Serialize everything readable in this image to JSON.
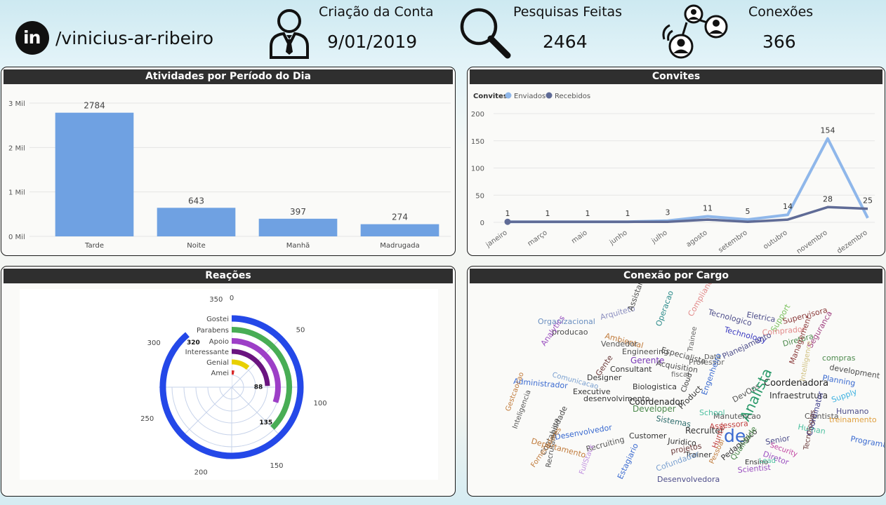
{
  "header": {
    "profile": {
      "icon": "linkedin-icon",
      "handle": "/vinicius-ar-ribeiro"
    },
    "kpis": [
      {
        "label": "Criação da Conta",
        "value": "9/01/2019",
        "icon": "person-tie-icon"
      },
      {
        "label": "Pesquisas Feitas",
        "value": "2464",
        "icon": "magnifier-icon"
      },
      {
        "label": "Conexões",
        "value": "366",
        "icon": "network-people-icon"
      }
    ]
  },
  "panels": {
    "atividades": {
      "title": "Atividades por Período do Dia"
    },
    "convites": {
      "title": "Convites"
    },
    "reacoes": {
      "title": "Reações"
    },
    "conexao": {
      "title": "Conexão por Cargo"
    }
  },
  "colors": {
    "accent_bar": "#6fa1e2",
    "enviados": "#8fb7ea",
    "recebidos": "#5f6b96",
    "reaction_ring": "#2448e8"
  },
  "chart_data": [
    {
      "type": "bar",
      "title": "Atividades por Período do Dia",
      "categories": [
        "Tarde",
        "Noite",
        "Manhã",
        "Madrugada"
      ],
      "values": [
        2784,
        643,
        397,
        274
      ],
      "data_labels": [
        "2784",
        "643",
        "397",
        "274"
      ],
      "y_ticks": [
        "0 Mil",
        "1 Mil",
        "2 Mil",
        "3 Mil"
      ],
      "ylim": [
        0,
        3000
      ],
      "grid": true
    },
    {
      "type": "line",
      "title": "Convites",
      "legend_title": "Convites",
      "categories": [
        "janeiro",
        "março",
        "maio",
        "junho",
        "julho",
        "agosto",
        "setembro",
        "outubro",
        "novembro",
        "dezembro"
      ],
      "series": [
        {
          "name": "Enviados",
          "values": [
            1,
            1,
            1,
            1,
            3,
            11,
            5,
            14,
            154,
            8
          ],
          "color": "#8fb7ea"
        },
        {
          "name": "Recebidos",
          "values": [
            1,
            null,
            null,
            null,
            1,
            5,
            1,
            5,
            28,
            25
          ],
          "color": "#5f6b96"
        }
      ],
      "data_labels": [
        "1",
        "1",
        "1",
        "1",
        "3",
        "11",
        "5",
        "14",
        "154",
        "28",
        "25"
      ],
      "y_ticks": [
        "0",
        "50",
        "100",
        "150",
        "200"
      ],
      "ylim": [
        0,
        200
      ],
      "legend_position": "top-left"
    },
    {
      "type": "radial-bar",
      "title": "Reações",
      "categories": [
        "Gostei",
        "Parabens",
        "Apoio",
        "Interessante",
        "Genial",
        "Amei"
      ],
      "values": [
        320,
        135,
        109,
        88,
        40,
        9
      ],
      "colors": [
        "#2448e8",
        "#48ad55",
        "#9d3fc7",
        "#6a1480",
        "#e8d000",
        "#d82a2a"
      ],
      "data_labels": [
        "320",
        "135",
        "88"
      ],
      "angle_ticks": [
        "0",
        "50",
        "100",
        "150",
        "200",
        "250",
        "300",
        "350"
      ],
      "max": 360
    }
  ],
  "wordcloud": [
    {
      "t": "Organizacional",
      "c": "#6a8fc0"
    },
    {
      "t": "Arquiteto",
      "c": "#8c8fc0"
    },
    {
      "t": "Assistant",
      "c": "#4d4d4d"
    },
    {
      "t": "Compliance",
      "c": "#e28a8a"
    },
    {
      "t": "Tecnologico",
      "c": "#4d4d8a"
    },
    {
      "t": "Eletrica",
      "c": "#4d4d8a"
    },
    {
      "t": "Support",
      "c": "#7ac25d"
    },
    {
      "t": "Supervisora",
      "c": "#8a3a3a"
    },
    {
      "t": "producao",
      "c": "#4d4d4d"
    },
    {
      "t": "Analytics",
      "c": "#9a4fc0"
    },
    {
      "t": "Ambiental",
      "c": "#c07a3a"
    },
    {
      "t": "Operacao",
      "c": "#2a8a8a"
    },
    {
      "t": "Technology",
      "c": "#3a3ac0"
    },
    {
      "t": "Comprador",
      "c": "#e28a8a"
    },
    {
      "t": "Seguranca",
      "c": "#a04080"
    },
    {
      "t": "Vendedor",
      "c": "#555"
    },
    {
      "t": "Engineering",
      "c": "#4d4d4d"
    },
    {
      "t": "Especialista",
      "c": "#4d4d4d"
    },
    {
      "t": "Trainee",
      "c": "#666"
    },
    {
      "t": "Diretora",
      "c": "#4d8a4d"
    },
    {
      "t": "compras",
      "c": "#4d8a4d"
    },
    {
      "t": "Planejamento",
      "c": "#4d4d8a"
    },
    {
      "t": "development",
      "c": "#4d4d4d"
    },
    {
      "t": "Gerente",
      "c": "#7a3ab8"
    },
    {
      "t": "Acquisition",
      "c": "#4d4d4d"
    },
    {
      "t": "Professor",
      "c": "#666"
    },
    {
      "t": "Data",
      "c": "#555"
    },
    {
      "t": "Management",
      "c": "#8a3a3a"
    },
    {
      "t": "Consultant",
      "c": "#333"
    },
    {
      "t": "Planning",
      "c": "#3a6ad0"
    },
    {
      "t": "Comunicacao",
      "c": "#7aa0d0"
    },
    {
      "t": "Administrador",
      "c": "#3a6ad0"
    },
    {
      "t": "Designer",
      "c": "#333"
    },
    {
      "t": "Gente",
      "c": "#6a3a3a"
    },
    {
      "t": "fiscal",
      "c": "#666"
    },
    {
      "t": "Coordenadora",
      "c": "#222"
    },
    {
      "t": "Cloud",
      "c": "#333"
    },
    {
      "t": "Engenheiro",
      "c": "#3a6ad0"
    },
    {
      "t": "Executive",
      "c": "#333"
    },
    {
      "t": "Biologistica",
      "c": "#333"
    },
    {
      "t": "Infraestrutura",
      "c": "#333"
    },
    {
      "t": "Gestcaocao",
      "c": "#c07a3a"
    },
    {
      "t": "Inteligencia",
      "c": "#555"
    },
    {
      "t": "Coordenador",
      "c": "#222"
    },
    {
      "t": "Product",
      "c": "#333"
    },
    {
      "t": "DevOps",
      "c": "#555"
    },
    {
      "t": "Analista",
      "c": "#2a9a6a"
    },
    {
      "t": "Supply",
      "c": "#3ab0e0"
    },
    {
      "t": "Humano",
      "c": "#4d4d8a"
    },
    {
      "t": "Intelligence",
      "c": "#d0c080"
    },
    {
      "t": "Cientista",
      "c": "#555"
    },
    {
      "t": "treinamento",
      "c": "#e0a040"
    },
    {
      "t": "Developer",
      "c": "#4d8a4d"
    },
    {
      "t": "Sistemas",
      "c": "#2a6a6a"
    },
    {
      "t": "Manutencao",
      "c": "#555"
    },
    {
      "t": "Assessora",
      "c": "#c04040"
    },
    {
      "t": "Departamento",
      "c": "#c07a3a"
    },
    {
      "t": "Desenvolvedor",
      "c": "#3a6ad0"
    },
    {
      "t": "Recruiter",
      "c": "#333"
    },
    {
      "t": "de",
      "c": "#3a6ad0"
    },
    {
      "t": "Human",
      "c": "#4dc0a0"
    },
    {
      "t": "Programador",
      "c": "#3a6ad0"
    },
    {
      "t": "Senior",
      "c": "#4d4d8a"
    },
    {
      "t": "Contabilidade",
      "c": "#4d4d4d"
    },
    {
      "t": "Recrutamento",
      "c": "#4d4d4d"
    },
    {
      "t": "Customer",
      "c": "#333"
    },
    {
      "t": "Recruiting",
      "c": "#555"
    },
    {
      "t": "Juridico",
      "c": "#333"
    },
    {
      "t": "projetos",
      "c": "#6a3a3a"
    },
    {
      "t": "Trainer",
      "c": "#333"
    },
    {
      "t": "Diretor",
      "c": "#9a4fc0"
    },
    {
      "t": "Security",
      "c": "#c040a0"
    },
    {
      "t": "Coordinator",
      "c": "#3a3a8a"
    },
    {
      "t": "Tecnologias",
      "c": "#6a3a3a"
    },
    {
      "t": "Fornecedores",
      "c": "#c07a3a"
    },
    {
      "t": "FullStack",
      "c": "#c090e0"
    },
    {
      "t": "Cofundador",
      "c": "#7aa0d0"
    },
    {
      "t": "Scientist",
      "c": "#9a4fc0"
    },
    {
      "t": "Desenvolvedora",
      "c": "#4d4d8a"
    },
    {
      "t": "Pedagogico",
      "c": "#333"
    },
    {
      "t": "Ensino",
      "c": "#333"
    },
    {
      "t": "Lead",
      "c": "#4dc0a0"
    },
    {
      "t": "Estagiario",
      "c": "#3a6ad0"
    },
    {
      "t": "Hunter",
      "c": "#c04040"
    },
    {
      "t": "Qualidade",
      "c": "#4d8a4d"
    },
    {
      "t": "Pessoal",
      "c": "#c07a3a"
    },
    {
      "t": "School",
      "c": "#4dc0a0"
    },
    {
      "t": "desenvolvimento",
      "c": "#333"
    }
  ]
}
